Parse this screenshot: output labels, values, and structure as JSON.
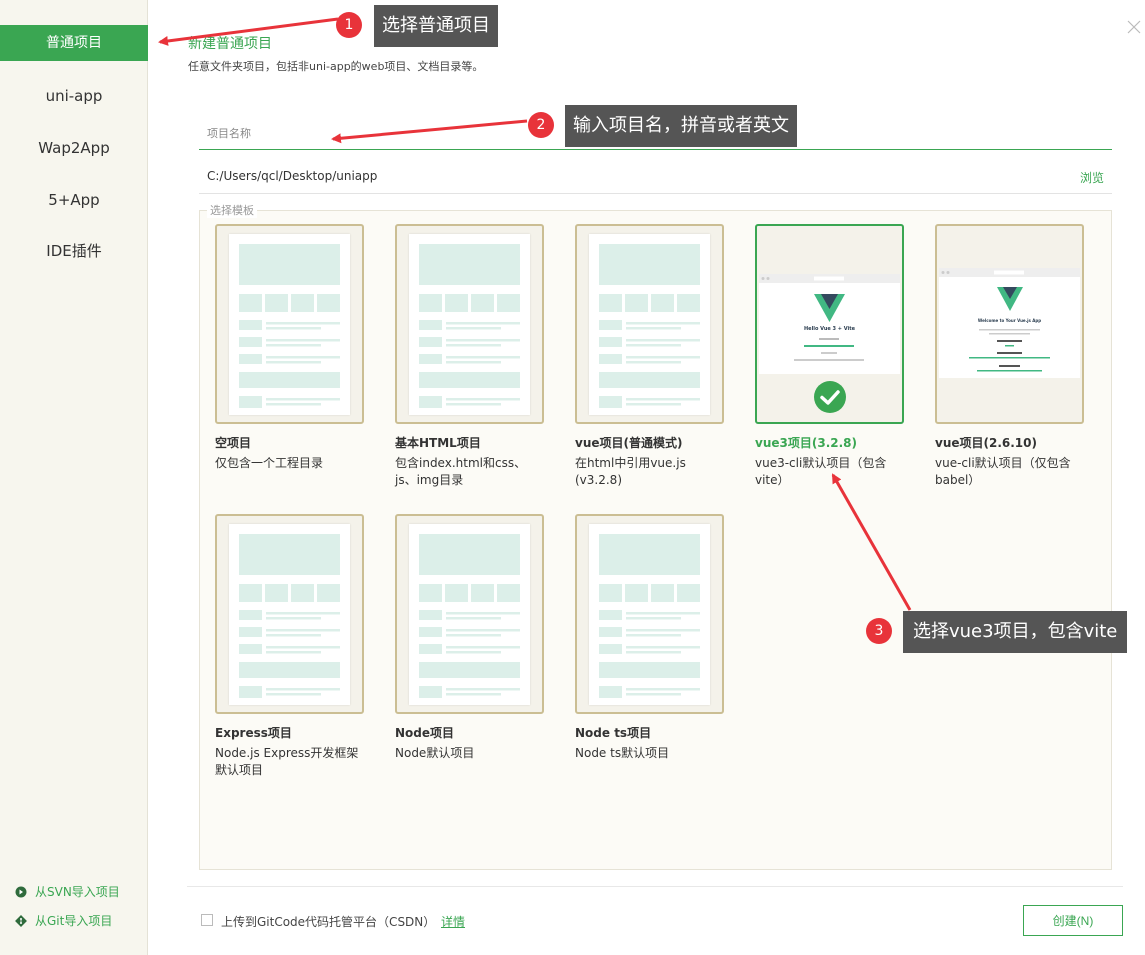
{
  "sidebar": {
    "items": [
      {
        "label": "普通项目",
        "active": true
      },
      {
        "label": "uni-app"
      },
      {
        "label": "Wap2App"
      },
      {
        "label": "5+App"
      },
      {
        "label": "IDE插件"
      }
    ],
    "svn_import": "从SVN导入项目",
    "git_import": "从Git导入项目"
  },
  "header": {
    "title": "新建普通项目",
    "subtitle": "任意文件夹项目，包括非uni-app的web项目、文档目录等。"
  },
  "form": {
    "name_placeholder": "项目名称",
    "name_value": "",
    "path": "C:/Users/qcl/Desktop/uniapp",
    "browse_label": "浏览",
    "templates_legend": "选择模板"
  },
  "templates": [
    {
      "name": "空项目",
      "desc": "仅包含一个工程目录"
    },
    {
      "name": "基本HTML项目",
      "desc": "包含index.html和css、js、img目录"
    },
    {
      "name": "vue项目(普通模式)",
      "desc": "在html中引用vue.js (v3.2.8)"
    },
    {
      "name": "vue3项目(3.2.8)",
      "desc": "vue3-cli默认项目（包含vite）",
      "selected": true,
      "preview": "Hello Vue 3 + Vite"
    },
    {
      "name": "vue项目(2.6.10)",
      "desc": "vue-cli默认项目（仅包含babel）",
      "preview": "Welcome to Your Vue.js App"
    },
    {
      "name": "Express项目",
      "desc": "Node.js Express开发框架默认项目"
    },
    {
      "name": "Node项目",
      "desc": "Node默认项目"
    },
    {
      "name": "Node ts项目",
      "desc": "Node ts默认项目"
    }
  ],
  "footer": {
    "upload_label": "上传到GitCode代码托管平台（CSDN）",
    "details_label": "详情",
    "create_label": "创建(N)"
  },
  "annotations": [
    {
      "number": "1",
      "text": "选择普通项目"
    },
    {
      "number": "2",
      "text": "输入项目名，拼音或者英文"
    },
    {
      "number": "3",
      "text": "选择vue3项目，包含vite"
    }
  ],
  "colors": {
    "accent": "#3aa652",
    "card_border": "#cbbe93",
    "sidebar_bg": "#f7f6ee",
    "callout_bg": "#555555",
    "badge_red": "#e8333a",
    "arrow_red": "#e8333a"
  }
}
